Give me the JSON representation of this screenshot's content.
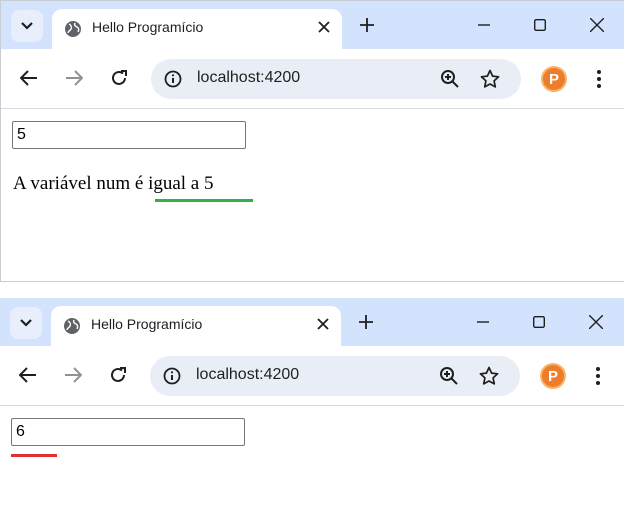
{
  "windows": [
    {
      "tab": {
        "title": "Hello Programício"
      },
      "omnibox": {
        "url": "localhost:4200"
      },
      "profile": {
        "initial": "P"
      },
      "page": {
        "input_value": "5",
        "output_text": "A variável num é igual a 5 ",
        "underline_color": "#2db24a"
      }
    },
    {
      "tab": {
        "title": "Hello Programício"
      },
      "omnibox": {
        "url": "localhost:4200"
      },
      "profile": {
        "initial": "P"
      },
      "page": {
        "input_value": "6",
        "underline_color": "#e03030"
      }
    }
  ],
  "icons": {
    "tab_search": "chevron-down-icon",
    "favicon": "globe-icon",
    "tab_close": "close-icon",
    "new_tab": "plus-icon",
    "minimize": "minimize-icon",
    "maximize": "maximize-icon",
    "close_window": "close-window-icon",
    "back": "back-arrow-icon",
    "forward": "forward-arrow-icon",
    "reload": "reload-icon",
    "site_info": "info-icon",
    "zoom": "zoom-in-icon",
    "bookmark": "star-icon",
    "menu": "kebab-menu-icon"
  },
  "colors": {
    "tabstrip": "#d3e3fd",
    "omnibox": "#e9eef6",
    "profile": "#ee7d2b"
  }
}
